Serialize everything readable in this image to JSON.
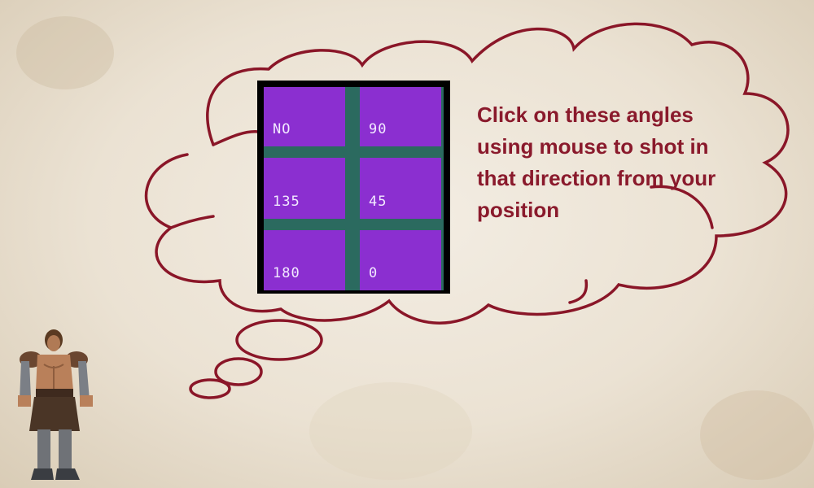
{
  "angle_buttons": {
    "no": "NO",
    "a90": "90",
    "a135": "135",
    "a45": "45",
    "a180": "180",
    "a0": "0"
  },
  "instruction": {
    "line1": "Click on these angles",
    "line2": "using mouse to shot in",
    "line3": "that direction from your",
    "line4": "position"
  },
  "colors": {
    "button_fill": "#8b2fd0",
    "grid_gap": "#2b6a5f",
    "cloud_outline": "#8a1628",
    "instruction_text": "#8a1a2c"
  },
  "icons": {
    "character": "warrior-character-icon",
    "thought_bubble": "thought-cloud-icon"
  }
}
